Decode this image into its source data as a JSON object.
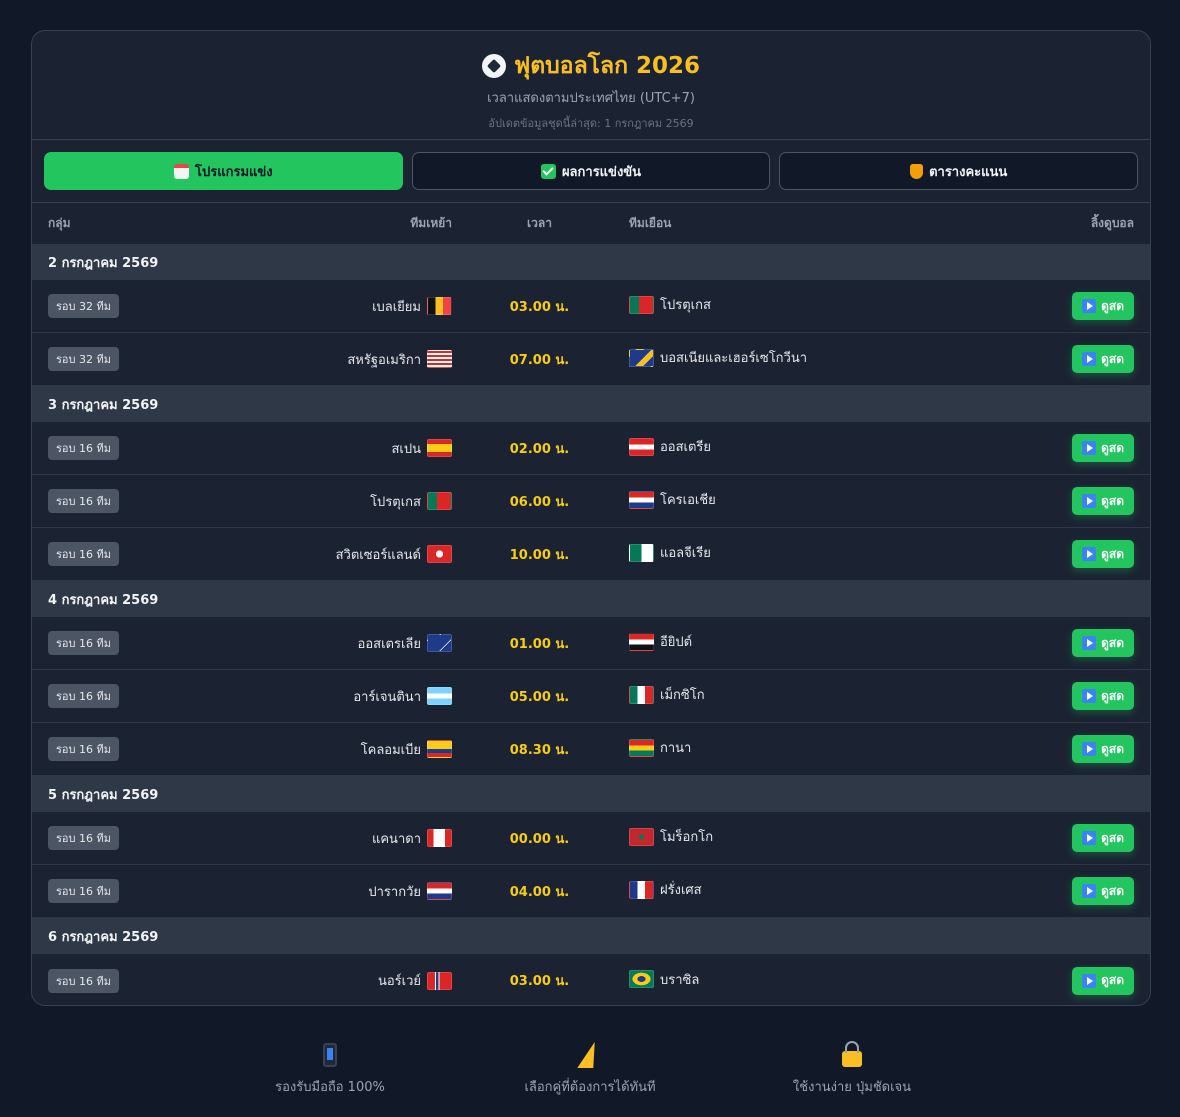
{
  "header": {
    "title": "ฟุตบอลโลก 2026",
    "subtitle": "เวลาแสดงตามประเทศไทย (UTC+7)",
    "updated": "อัปเดตข้อมูลชุดนี้ล่าสุด: 1 กรกฎาคม 2569",
    "title_icon": "soccer-ball-icon"
  },
  "tabs": [
    {
      "label": "โปรแกรมแข่ง",
      "icon": "calendar-icon",
      "active": true
    },
    {
      "label": "ผลการแข่งขัน",
      "icon": "check-icon",
      "active": false
    },
    {
      "label": "ตารางคะแนน",
      "icon": "trophy-icon",
      "active": false
    }
  ],
  "columns": {
    "group": "กลุ่ม",
    "home": "ทีมเหย้า",
    "time": "เวลา",
    "away": "ทีมเยือน",
    "link": "ลิ้งดูบอล"
  },
  "watch_label": "ดูสด",
  "days": [
    {
      "date": "2 กรกฎาคม 2569",
      "matches": [
        {
          "round": "รอบ 32 ทีม",
          "home": "เบลเยียม",
          "time": "03.00 น.",
          "away": "โปรตุเกส"
        },
        {
          "round": "รอบ 32 ทีม",
          "home": "สหรัฐอเมริกา",
          "time": "07.00 น.",
          "away": "บอสเนียและเฮอร์เซโกวีนา"
        }
      ]
    },
    {
      "date": "3 กรกฎาคม 2569",
      "matches": [
        {
          "round": "รอบ 16 ทีม",
          "home": "สเปน",
          "time": "02.00 น.",
          "away": "ออสเตรีย"
        },
        {
          "round": "รอบ 16 ทีม",
          "home": "โปรตุเกส",
          "time": "06.00 น.",
          "away": "โครเอเชีย"
        },
        {
          "round": "รอบ 16 ทีม",
          "home": "สวิตเซอร์แลนด์",
          "time": "10.00 น.",
          "away": "แอลจีเรีย"
        }
      ]
    },
    {
      "date": "4 กรกฎาคม 2569",
      "matches": [
        {
          "round": "รอบ 16 ทีม",
          "home": "ออสเตรเลีย",
          "time": "01.00 น.",
          "away": "อียิปต์"
        },
        {
          "round": "รอบ 16 ทีม",
          "home": "อาร์เจนตินา",
          "time": "05.00 น.",
          "away": "เม็กซิโก"
        },
        {
          "round": "รอบ 16 ทีม",
          "home": "โคลอมเบีย",
          "time": "08.30 น.",
          "away": "กานา"
        }
      ]
    },
    {
      "date": "5 กรกฎาคม 2569",
      "matches": [
        {
          "round": "รอบ 16 ทีม",
          "home": "แคนาดา",
          "time": "00.00 น.",
          "away": "โมร็อกโก"
        },
        {
          "round": "รอบ 16 ทีม",
          "home": "ปารากวัย",
          "time": "04.00 น.",
          "away": "ฝรั่งเศส"
        }
      ]
    },
    {
      "date": "6 กรกฎาคม 2569",
      "matches": [
        {
          "round": "รอบ 16 ทีม",
          "home": "นอร์เวย์",
          "time": "03.00 น.",
          "away": "บราซิล"
        }
      ]
    }
  ],
  "features": [
    {
      "label": "รองรับมือถือ 100%",
      "icon": "mobile-phone-icon"
    },
    {
      "label": "เลือกคู่ที่ต้องการได้ทันที",
      "icon": "lightning-icon"
    },
    {
      "label": "ใช้งานง่าย ปุ่มชัดเจน",
      "icon": "lock-icon"
    }
  ]
}
